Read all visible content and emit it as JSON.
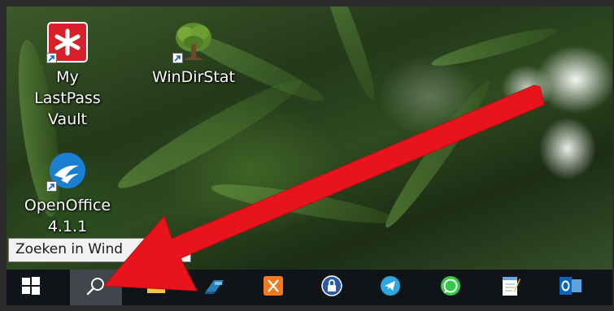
{
  "desktop": {
    "icons": [
      {
        "label_line1": "My LastPass",
        "label_line2": "Vault",
        "icon": "lastpass-icon"
      },
      {
        "label_line1": "WinDirStat",
        "label_line2": "",
        "icon": "windirstat-icon"
      },
      {
        "label_line1": "OpenOffice",
        "label_line2": "4.1.1",
        "icon": "openoffice-icon"
      }
    ]
  },
  "search_tooltip": {
    "text": "Zoeken in Wind"
  },
  "taskbar": {
    "items": [
      {
        "icon": "windows-start-icon"
      },
      {
        "icon": "search-icon"
      },
      {
        "icon": "file-explorer-icon"
      },
      {
        "icon": "app-icon"
      },
      {
        "icon": "xampp-icon"
      },
      {
        "icon": "vpn-lock-icon"
      },
      {
        "icon": "telegram-icon"
      },
      {
        "icon": "whatsapp-icon"
      },
      {
        "icon": "notepad-icon"
      },
      {
        "icon": "outlook-icon"
      }
    ]
  },
  "colors": {
    "annotation_arrow": "#e8141c",
    "taskbar": "#101418",
    "search_highlight": "#40464c"
  }
}
